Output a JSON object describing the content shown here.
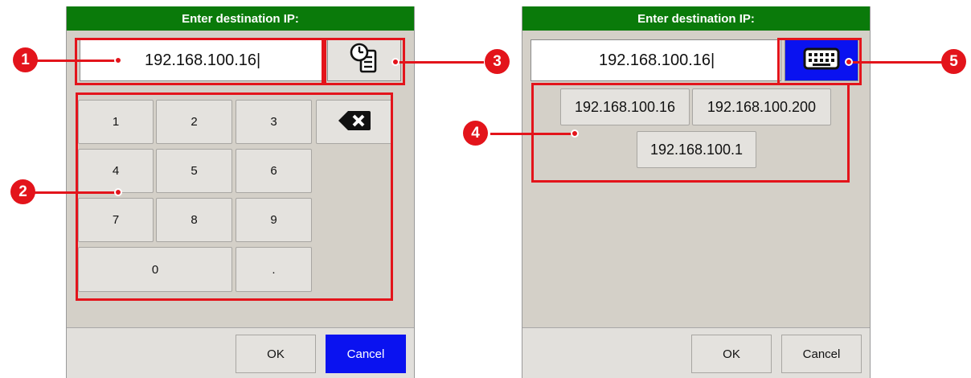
{
  "left_dialog": {
    "title": "Enter destination IP:",
    "ip_value": "192.168.100.16|",
    "keys": [
      "1",
      "2",
      "3",
      "4",
      "5",
      "6",
      "7",
      "8",
      "9",
      "0",
      "."
    ],
    "ok_label": "OK",
    "cancel_label": "Cancel"
  },
  "right_dialog": {
    "title": "Enter destination IP:",
    "ip_value": "192.168.100.16|",
    "recent_ips": [
      "192.168.100.16",
      "192.168.100.200",
      "192.168.100.1"
    ],
    "ok_label": "OK",
    "cancel_label": "Cancel"
  },
  "callouts": [
    "1",
    "2",
    "3",
    "4",
    "5"
  ],
  "icons": {
    "backspace": "backspace-icon",
    "history_toggle": "history-list-icon",
    "keypad_toggle": "keyboard-icon"
  },
  "colors": {
    "title_bar": "#0a7a0a",
    "dialog_bg": "#d4d0c8",
    "accent_blue": "#0a12f0",
    "callout_red": "#e3141b"
  }
}
